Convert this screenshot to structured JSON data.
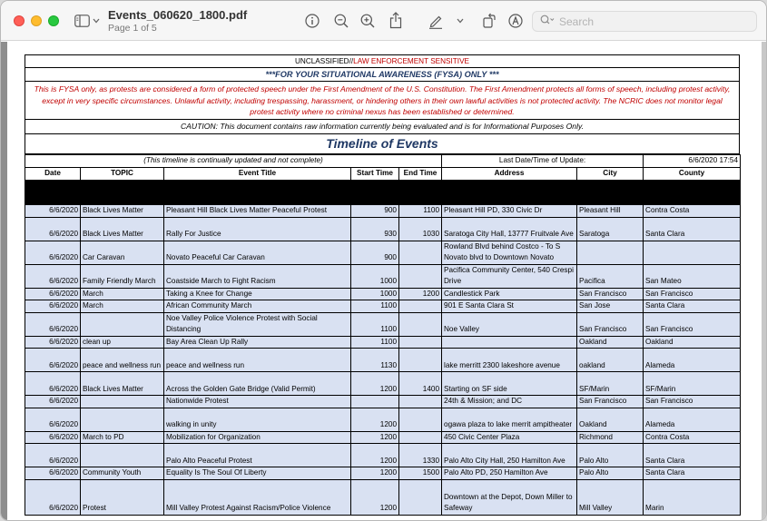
{
  "window": {
    "title": "Events_060620_1800.pdf",
    "subtitle": "Page 1 of 5",
    "search_placeholder": "Search"
  },
  "toolbar_icons": [
    "sidebar-icon",
    "chevron-down-icon",
    "info-icon",
    "zoom-out-icon",
    "zoom-in-icon",
    "share-icon",
    "highlight-pen-icon",
    "chevron-down-icon",
    "rotate-icon",
    "markup-icon",
    "search-icon"
  ],
  "colors": {
    "warning_red": "#c00000",
    "title_blue": "#1f3864",
    "row_fill": "#d9e1f2"
  },
  "document": {
    "classification_prefix": "UNCLASSIFIED//",
    "classification_suffix": "LAW ENFORCEMENT SENSITIVE",
    "fysa": "***FOR YOUR SITUATIONAL AWARENESS (FYSA) ONLY ***",
    "warning": "This is FYSA only, as protests are considered a form of protected speech under the First Amendment of the U.S. Constitution. The First Amendment protects all forms of speech, including protest activity, except in very specific circumstances. Unlawful activity, including trespassing, harassment, or hindering others in their own lawful activities is not protected activity. The NCRIC does not monitor legal protest activity where no criminal nexus has been established or determined.",
    "caution": "CAUTION: This document contains raw information currently being evaluated and is for Informational Purposes Only.",
    "timeline_title": "Timeline of Events",
    "note": "(This timeline is continually updated and not complete)",
    "last_update_label": "Last Date/Time of Update:",
    "last_update_value": "6/6/2020 17:54",
    "columns": [
      "Date",
      "TOPIC",
      "Event Title",
      "Start Time",
      "End Time",
      "Address",
      "City",
      "County"
    ],
    "rows": [
      [
        "6/6/2020",
        "Black Lives Matter",
        "Pleasant Hill Black Lives Matter Peaceful Protest",
        "900",
        "1100",
        "Pleasant Hill PD, 330 Civic Dr",
        "Pleasant Hill",
        "Contra Costa"
      ],
      [
        "6/6/2020",
        "Black Lives Matter",
        "Rally For Justice",
        "930",
        "1030",
        "Saratoga City Hall, 13777 Fruitvale Ave",
        "Saratoga",
        "Santa Clara"
      ],
      [
        "6/6/2020",
        "Car Caravan",
        "Novato Peaceful Car Caravan",
        "900",
        "",
        "Rowland Blvd behind Costco - To S Novato blvd to Downtown Novato",
        "",
        ""
      ],
      [
        "6/6/2020",
        "Family Friendly March",
        "Coastside March to Fight Racism",
        "1000",
        "",
        "Pacifica Community Center, 540 Crespi Drive",
        "Pacifica",
        "San Mateo"
      ],
      [
        "6/6/2020",
        "March",
        "Taking a Knee for Change",
        "1000",
        "1200",
        "Candlestick Park",
        "San Francisco",
        "San Francisco"
      ],
      [
        "6/6/2020",
        "March",
        "African Community March",
        "1100",
        "",
        "901 E Santa Clara St",
        "San Jose",
        "Santa Clara"
      ],
      [
        "6/6/2020",
        "",
        "Noe Valley Police Violence Protest with Social Distancing",
        "1100",
        "",
        "Noe Valley",
        "San Francisco",
        "San Francisco"
      ],
      [
        "6/6/2020",
        "clean up",
        "Bay Area Clean Up Rally",
        "1100",
        "",
        "",
        "Oakland",
        "Oakland"
      ],
      [
        "6/6/2020",
        "peace and wellness run",
        "peace and wellness run",
        "1130",
        "",
        "lake merritt 2300 lakeshore avenue",
        "oakland",
        "Alameda"
      ],
      [
        "6/6/2020",
        "Black Lives Matter",
        "Across the Golden Gate Bridge (Valid Permit)",
        "1200",
        "1400",
        "Starting on SF side",
        "SF/Marin",
        "SF/Marin"
      ],
      [
        "6/6/2020",
        "",
        "Nationwide Protest",
        "",
        "",
        "24th & Mission; and DC",
        "San Francisco",
        "San Francisco"
      ],
      [
        "6/6/2020",
        "",
        "walking in unity",
        "1200",
        "",
        "ogawa plaza to lake merrit ampitheater",
        "Oakland",
        "Alameda"
      ],
      [
        "6/6/2020",
        "March to PD",
        "Mobilization for Organization",
        "1200",
        "",
        "450 Civic Center Plaza",
        "Richmond",
        "Contra Costa"
      ],
      [
        "6/6/2020",
        "",
        "Palo Alto Peaceful Protest",
        "1200",
        "1330",
        "Palo Alto City Hall, 250 Hamilton Ave",
        "Palo Alto",
        "Santa Clara"
      ],
      [
        "6/6/2020",
        "Community Youth",
        "Equality Is The Soul Of Liberty",
        "1200",
        "1500",
        "Palo Alto PD, 250 Hamilton Ave",
        "Palo Alto",
        "Santa Clara"
      ],
      [
        "6/6/2020",
        "Protest",
        "Mill Valley Protest Against Racism/Police Violence",
        "1200",
        "",
        "Downtown at the Depot, Down Miller to Safeway",
        "Mill Valley",
        "Marin"
      ]
    ]
  }
}
